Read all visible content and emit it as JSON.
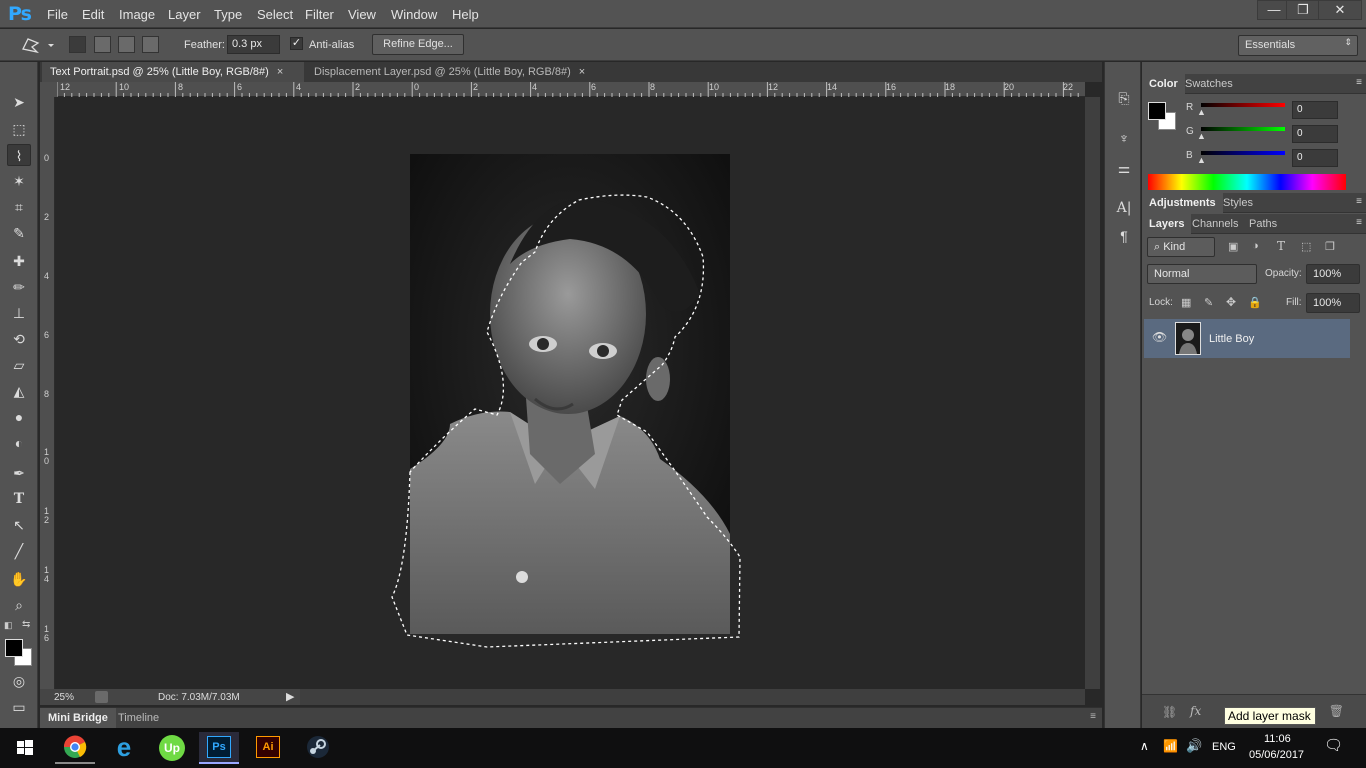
{
  "app": {
    "logo": "Ps"
  },
  "menubar": {
    "items": [
      "File",
      "Edit",
      "Image",
      "Layer",
      "Type",
      "Select",
      "Filter",
      "View",
      "Window",
      "Help"
    ],
    "window_controls": {
      "minimize": "—",
      "restore": "❐",
      "close": "✕"
    }
  },
  "options": {
    "feather_label": "Feather:",
    "feather_value": "0.3 px",
    "antialias_label": "Anti-alias",
    "antialias_check": "✓",
    "refine_label": "Refine Edge...",
    "workspace": "Essentials"
  },
  "tabs": [
    {
      "label": "Text Portrait.psd @ 25% (Little Boy, RGB/8#)",
      "close": "×",
      "active": true
    },
    {
      "label": "Displacement Layer.psd @ 25% (Little Boy, RGB/8#)",
      "close": "×",
      "active": false
    }
  ],
  "ruler": {
    "h": [
      "12",
      "10",
      "8",
      "6",
      "4",
      "2",
      "0",
      "2",
      "4",
      "6",
      "8",
      "10",
      "12",
      "14",
      "16",
      "18",
      "20",
      "22"
    ],
    "v": [
      "0",
      "2",
      "4",
      "6",
      "8",
      "1\n0",
      "1\n2",
      "1\n4",
      "1\n6"
    ]
  },
  "status": {
    "zoom": "25%",
    "doc": "Doc: 7.03M/7.03M"
  },
  "bottom_tabs": [
    "Mini Bridge",
    "Timeline"
  ],
  "color_panel": {
    "tabs": [
      "Color",
      "Swatches"
    ],
    "channels": [
      {
        "name": "R",
        "value": "0",
        "color": "#e01818"
      },
      {
        "name": "G",
        "value": "0",
        "color": "#18c018"
      },
      {
        "name": "B",
        "value": "0",
        "color": "#1818e0"
      }
    ]
  },
  "adjust_panel": {
    "tabs": [
      "Adjustments",
      "Styles"
    ]
  },
  "layers_panel": {
    "tabs": [
      "Layers",
      "Channels",
      "Paths"
    ],
    "filter_kind": "Kind",
    "blend_mode": "Normal",
    "opacity_label": "Opacity:",
    "opacity_value": "100%",
    "lock_label": "Lock:",
    "fill_label": "Fill:",
    "fill_value": "100%",
    "layers": [
      {
        "name": "Little Boy",
        "visible": true,
        "selected": true
      }
    ],
    "tooltip": "Add layer mask"
  },
  "taskbar": {
    "lang": "ENG",
    "time": "11:06",
    "date": "05/06/2017",
    "apps": [
      {
        "name": "chrome",
        "glyph": "",
        "color": "#ea4335"
      },
      {
        "name": "edge",
        "glyph": "e",
        "color": "#2d9fe0"
      },
      {
        "name": "upwork",
        "glyph": "Up",
        "color": "#6fda44"
      },
      {
        "name": "photoshop",
        "glyph": "Ps",
        "color": "#31a8ff"
      },
      {
        "name": "illustrator",
        "glyph": "Ai",
        "color": "#ff9a00"
      },
      {
        "name": "steam",
        "glyph": "",
        "color": "#c7d5e0"
      }
    ]
  }
}
